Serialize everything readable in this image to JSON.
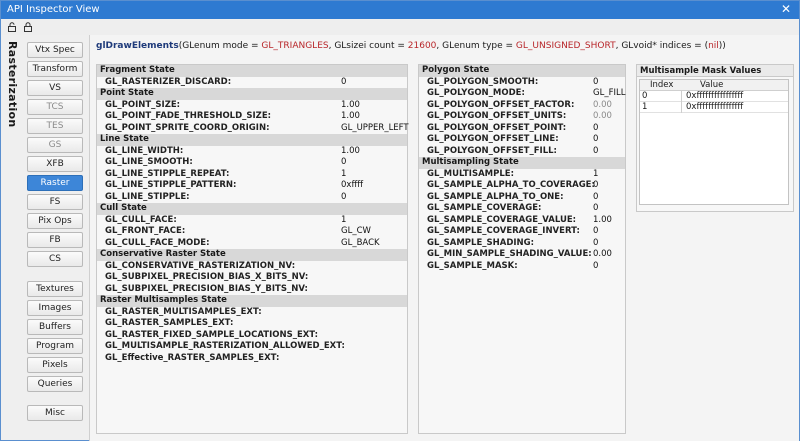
{
  "window": {
    "title": "API Inspector View",
    "close_glyph": "✕"
  },
  "toolbar": {
    "icons": [
      "unlock-icon",
      "lock-icon"
    ]
  },
  "sidebar": {
    "vertical_label": "Rasterization",
    "stages": [
      {
        "label": "Vtx Spec",
        "state": "normal"
      },
      {
        "label": "Transform",
        "state": "normal"
      },
      {
        "label": "VS",
        "state": "normal"
      },
      {
        "label": "TCS",
        "state": "dim"
      },
      {
        "label": "TES",
        "state": "dim"
      },
      {
        "label": "GS",
        "state": "dim"
      },
      {
        "label": "XFB",
        "state": "normal"
      },
      {
        "label": "Raster",
        "state": "active"
      },
      {
        "label": "FS",
        "state": "normal"
      },
      {
        "label": "Pix Ops",
        "state": "normal"
      },
      {
        "label": "FB",
        "state": "normal"
      },
      {
        "label": "CS",
        "state": "normal"
      }
    ],
    "objects": [
      {
        "label": "Textures"
      },
      {
        "label": "Images"
      },
      {
        "label": "Buffers"
      },
      {
        "label": "Program"
      },
      {
        "label": "Pixels"
      },
      {
        "label": "Queries"
      }
    ],
    "misc": {
      "label": "Misc"
    }
  },
  "call": {
    "fn": "glDrawElements",
    "p1": "(GLenum mode = ",
    "mode": "GL_TRIANGLES",
    "p2": ", GLsizei count = ",
    "count": "21600",
    "p3": ", GLenum type = ",
    "type": "GL_UNSIGNED_SHORT",
    "p4": ", GLvoid* indices = (",
    "indices": "nil",
    "p5": "))"
  },
  "left_panel": {
    "sections": [
      {
        "title": "Fragment State",
        "rows": [
          {
            "key": "GL_RASTERIZER_DISCARD:",
            "value": "0"
          }
        ]
      },
      {
        "title": "Point State",
        "rows": [
          {
            "key": "GL_POINT_SIZE:",
            "value": "1.00"
          },
          {
            "key": "GL_POINT_FADE_THRESHOLD_SIZE:",
            "value": "1.00"
          },
          {
            "key": "GL_POINT_SPRITE_COORD_ORIGIN:",
            "value": "GL_UPPER_LEFT"
          }
        ]
      },
      {
        "title": "Line State",
        "rows": [
          {
            "key": "GL_LINE_WIDTH:",
            "value": "1.00"
          },
          {
            "key": "GL_LINE_SMOOTH:",
            "value": "0"
          },
          {
            "key": "GL_LINE_STIPPLE_REPEAT:",
            "value": "1"
          },
          {
            "key": "GL_LINE_STIPPLE_PATTERN:",
            "value": "0xffff"
          },
          {
            "key": "GL_LINE_STIPPLE:",
            "value": "0"
          }
        ]
      },
      {
        "title": "Cull State",
        "rows": [
          {
            "key": "GL_CULL_FACE:",
            "value": "1"
          },
          {
            "key": "GL_FRONT_FACE:",
            "value": "GL_CW"
          },
          {
            "key": "GL_CULL_FACE_MODE:",
            "value": "GL_BACK"
          }
        ]
      },
      {
        "title": "Conservative Raster State",
        "rows": [
          {
            "key": "GL_CONSERVATIVE_RASTERIZATION_NV:",
            "value": ""
          },
          {
            "key": "GL_SUBPIXEL_PRECISION_BIAS_X_BITS_NV:",
            "value": ""
          },
          {
            "key": "GL_SUBPIXEL_PRECISION_BIAS_Y_BITS_NV:",
            "value": ""
          }
        ]
      },
      {
        "title": "Raster Multisamples State",
        "rows": [
          {
            "key": "GL_RASTER_MULTISAMPLES_EXT:",
            "value": ""
          },
          {
            "key": "GL_RASTER_SAMPLES_EXT:",
            "value": ""
          },
          {
            "key": "GL_RASTER_FIXED_SAMPLE_LOCATIONS_EXT:",
            "value": ""
          },
          {
            "key": "GL_MULTISAMPLE_RASTERIZATION_ALLOWED_EXT:",
            "value": ""
          },
          {
            "key": "GL_Effective_RASTER_SAMPLES_EXT:",
            "value": ""
          }
        ]
      }
    ]
  },
  "mid_panel": {
    "sections": [
      {
        "title": "Polygon State",
        "rows": [
          {
            "key": "GL_POLYGON_SMOOTH:",
            "value": "0"
          },
          {
            "key": "GL_POLYGON_MODE:",
            "value": "GL_FILL"
          },
          {
            "key": "GL_POLYGON_OFFSET_FACTOR:",
            "value": "0.00",
            "grey": true
          },
          {
            "key": "GL_POLYGON_OFFSET_UNITS:",
            "value": "0.00",
            "grey": true
          },
          {
            "key": "GL_POLYGON_OFFSET_POINT:",
            "value": "0"
          },
          {
            "key": "GL_POLYGON_OFFSET_LINE:",
            "value": "0"
          },
          {
            "key": "GL_POLYGON_OFFSET_FILL:",
            "value": "0"
          }
        ]
      },
      {
        "title": "Multisampling State",
        "rows": [
          {
            "key": "GL_MULTISAMPLE:",
            "value": "1"
          },
          {
            "key": "GL_SAMPLE_ALPHA_TO_COVERAGE:",
            "value": "0"
          },
          {
            "key": "GL_SAMPLE_ALPHA_TO_ONE:",
            "value": "0"
          },
          {
            "key": "GL_SAMPLE_COVERAGE:",
            "value": "0"
          },
          {
            "key": "GL_SAMPLE_COVERAGE_VALUE:",
            "value": "1.00"
          },
          {
            "key": "GL_SAMPLE_COVERAGE_INVERT:",
            "value": "0"
          },
          {
            "key": "GL_SAMPLE_SHADING:",
            "value": "0"
          },
          {
            "key": "GL_MIN_SAMPLE_SHADING_VALUE:",
            "value": "0.00"
          },
          {
            "key": "GL_SAMPLE_MASK:",
            "value": "0"
          }
        ]
      }
    ]
  },
  "multisample_mask": {
    "title": "Multisample Mask Values",
    "columns": [
      "Index",
      "Value"
    ],
    "rows": [
      {
        "index": "0",
        "value": "0xffffffffffffffff"
      },
      {
        "index": "1",
        "value": "0xffffffffffffffff"
      }
    ]
  }
}
